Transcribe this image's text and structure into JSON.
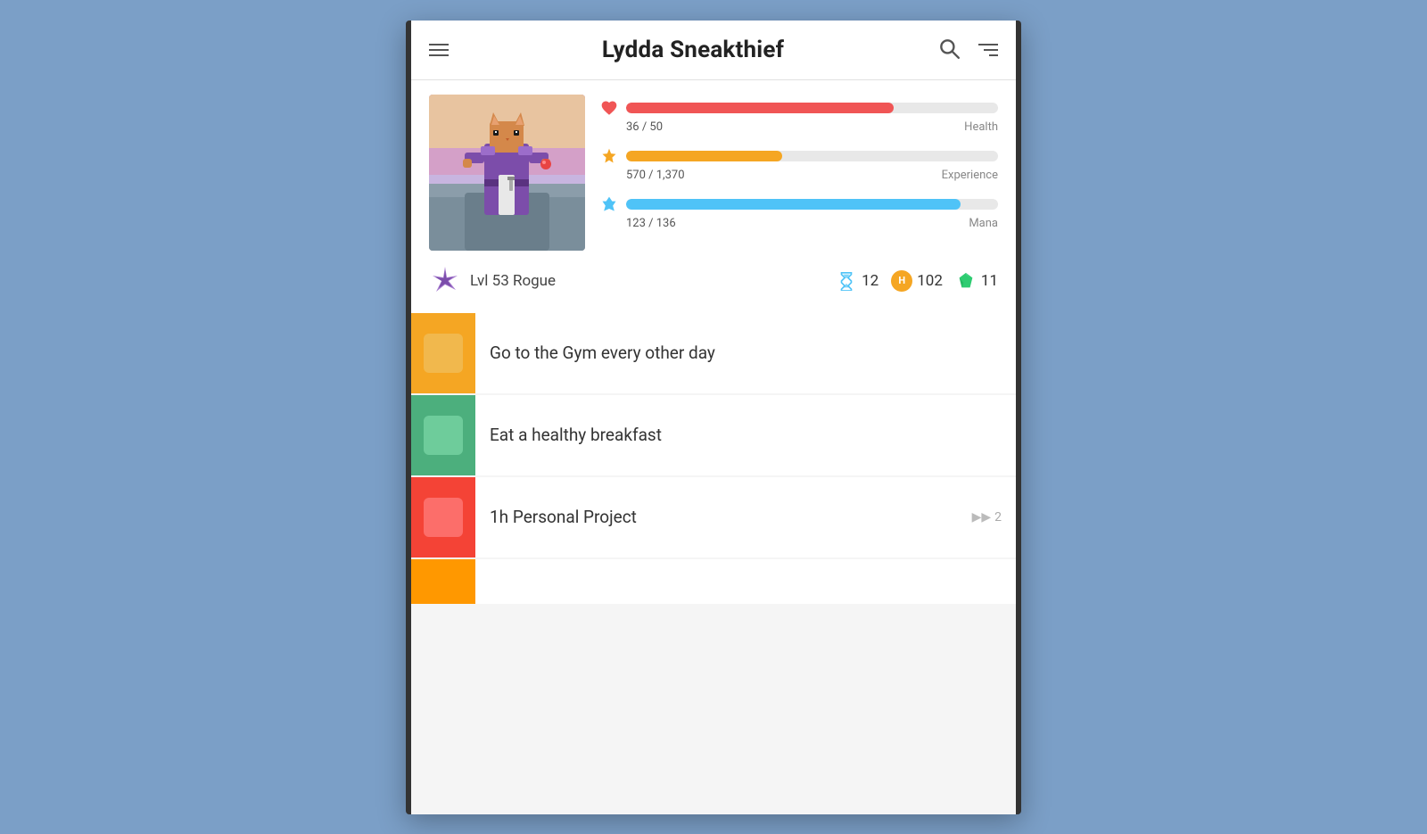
{
  "header": {
    "title": "Lydda Sneakthief",
    "menu_label": "menu",
    "search_label": "search",
    "filter_label": "filter"
  },
  "character": {
    "class": "Lvl 53 Rogue",
    "stats": {
      "health": {
        "current": 36,
        "max": 50,
        "label": "Health",
        "percent": 72
      },
      "experience": {
        "current": 570,
        "max": 1370,
        "label": "Experience",
        "percent": 42,
        "display_current": "570",
        "display_max": "1,370"
      },
      "mana": {
        "current": 123,
        "max": 136,
        "label": "Mana",
        "percent": 90
      }
    },
    "currencies": {
      "hourglasses": {
        "value": "12",
        "icon": "hourglass"
      },
      "gold": {
        "value": "102",
        "icon": "coin",
        "letter": "H"
      },
      "gems": {
        "value": "11",
        "icon": "gem"
      }
    }
  },
  "tasks": [
    {
      "id": 1,
      "title": "Go to the Gym every other day",
      "color": "yellow",
      "streak": null
    },
    {
      "id": 2,
      "title": "Eat a healthy breakfast",
      "color": "green",
      "streak": null
    },
    {
      "id": 3,
      "title": "1h Personal Project",
      "color": "red",
      "streak": 2
    },
    {
      "id": 4,
      "title": "",
      "color": "orange",
      "streak": null,
      "partial": true
    }
  ]
}
